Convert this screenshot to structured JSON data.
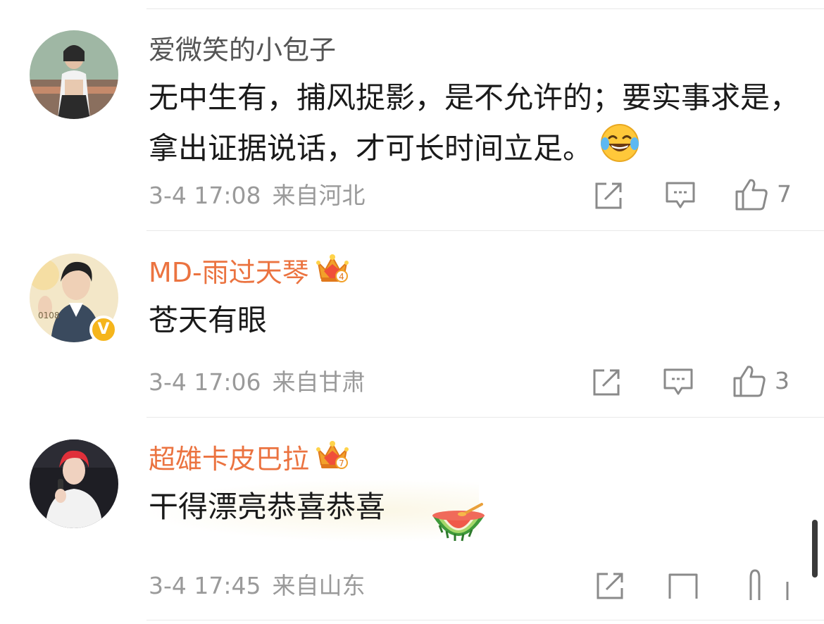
{
  "comments": [
    {
      "username": "爱微笑的小包子",
      "text": "无中生有，捕风捉影，是不允许的；要实事求是，拿出证据说话，才可长时间立足。",
      "time": "3-4 17:08",
      "location": "来自河北",
      "likes": "7",
      "emoji": "laughing-tears"
    },
    {
      "username": "MD-雨过天琴",
      "text": "苍天有眼",
      "time": "3-4 17:06",
      "location": "来自甘肃",
      "likes": "3",
      "badge": "V",
      "crown_level": "4"
    },
    {
      "username": "超雄卡皮巴拉",
      "text": "干得漂亮恭喜恭喜",
      "time": "3-4 17:45",
      "location": "来自山东",
      "crown_level": "7",
      "emoji": "watermelon"
    }
  ],
  "colors": {
    "vip_name": "#eb7340",
    "gray_name": "#555555",
    "meta": "#9a9a9a",
    "verified": "#f5b51c"
  }
}
